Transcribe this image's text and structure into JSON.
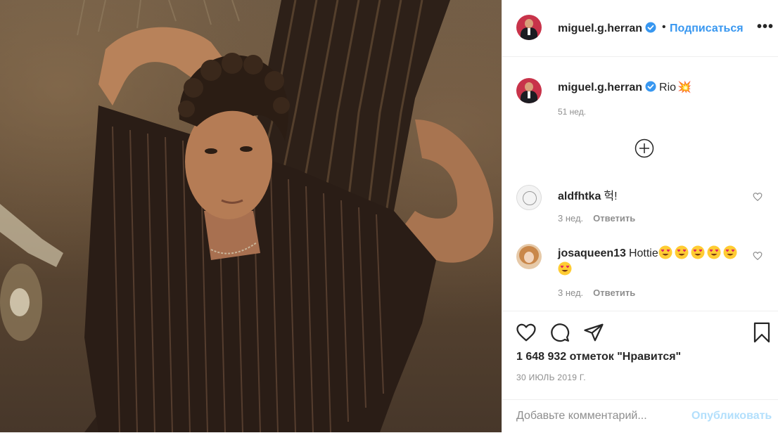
{
  "post": {
    "photo_description": "photo",
    "header": {
      "username": "miguel.g.herran",
      "separator": "•",
      "follow_label": "Подписаться",
      "more_label": "•••"
    },
    "caption": {
      "username": "miguel.g.herran",
      "text": "Rio",
      "emoji": "💥",
      "time": "51 нед."
    },
    "comments": [
      {
        "username": "aldfhtka",
        "text": "헉!",
        "time": "3 нед.",
        "reply_label": "Ответить"
      },
      {
        "username": "josaqueen13",
        "text": "Hottie",
        "emoji_count": 6,
        "time": "3 нед.",
        "reply_label": "Ответить"
      }
    ],
    "likes_text": "1 648 932 отметок \"Нравится\"",
    "date": "30 ИЮЛЬ 2019 Г.",
    "add_comment": {
      "placeholder": "Добавьте комментарий...",
      "publish_label": "Опубликовать"
    }
  },
  "colors": {
    "link": "#3897f0",
    "publish_disabled": "#b2dffc",
    "secondary_text": "#8e8e8e",
    "primary_text": "#262626",
    "divider": "#efefef"
  },
  "icons": [
    "verified-badge-icon",
    "add-icon",
    "heart-icon",
    "comment-icon",
    "share-icon",
    "bookmark-icon",
    "heart-outline-small-icon"
  ]
}
